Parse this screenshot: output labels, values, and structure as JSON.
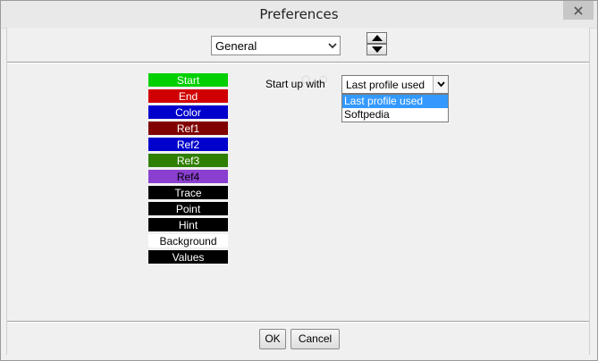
{
  "window": {
    "title": "Preferences"
  },
  "header": {
    "category_select": "General"
  },
  "color_items": [
    {
      "label": "Start",
      "bg": "#00d000",
      "fg": "#ffffff"
    },
    {
      "label": "End",
      "bg": "#d00000",
      "fg": "#ffffff"
    },
    {
      "label": "Color",
      "bg": "#0000cc",
      "fg": "#ffffff"
    },
    {
      "label": "Ref1",
      "bg": "#800000",
      "fg": "#ffffff"
    },
    {
      "label": "Ref2",
      "bg": "#0000cc",
      "fg": "#ffffff"
    },
    {
      "label": "Ref3",
      "bg": "#2f7f00",
      "fg": "#ffffff"
    },
    {
      "label": "Ref4",
      "bg": "#8a3fd0",
      "fg": "#000000"
    },
    {
      "label": "Trace",
      "bg": "#000000",
      "fg": "#ffffff"
    },
    {
      "label": "Point",
      "bg": "#000000",
      "fg": "#ffffff"
    },
    {
      "label": "Hint",
      "bg": "#000000",
      "fg": "#ffffff"
    },
    {
      "label": "Background",
      "bg": "#ffffff",
      "fg": "#000000"
    },
    {
      "label": "Values",
      "bg": "#000000",
      "fg": "#ffffff"
    }
  ],
  "startup": {
    "label": "Start up with",
    "value": "Last profile used",
    "options": [
      "Last profile used",
      "Softpedia"
    ],
    "selected_index": 0
  },
  "footer": {
    "ok_label": "OK",
    "cancel_label": "Cancel"
  },
  "colors": {
    "selection": "#3399ff",
    "window_bg": "#f0f0f0"
  }
}
